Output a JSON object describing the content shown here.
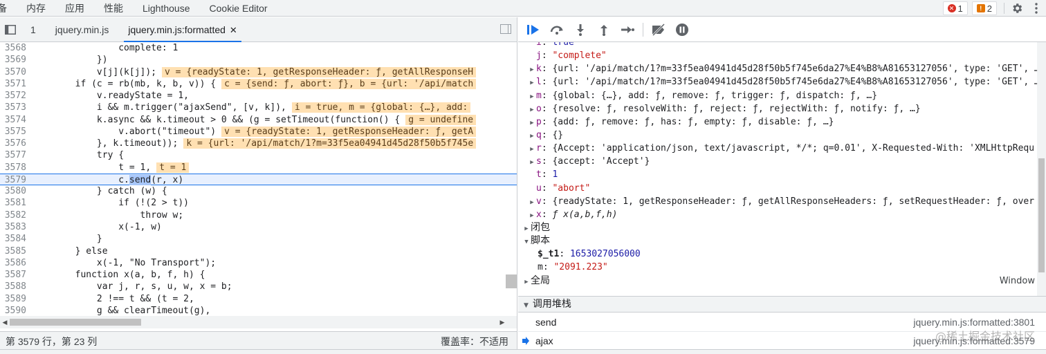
{
  "panel_tabs": [
    "备",
    "内存",
    "应用",
    "性能",
    "Lighthouse",
    "Cookie Editor"
  ],
  "issues": {
    "errors": "1",
    "warnings": "2"
  },
  "file_tabs": {
    "count_label": "1",
    "tab1": "jquery.min.js",
    "tab2": "jquery.min.js:formatted",
    "close": "✕"
  },
  "code_lines": [
    {
      "ln": "3568",
      "indent": "                ",
      "code": "complete: 1",
      "inline": ""
    },
    {
      "ln": "3569",
      "indent": "            ",
      "code": "})",
      "inline": ""
    },
    {
      "ln": "3570",
      "indent": "            ",
      "code": "v[j](k[j]);",
      "inline": "v = {readyState: 1, getResponseHeader: ƒ, getAllResponseH"
    },
    {
      "ln": "3571",
      "indent": "        ",
      "code": "if (c = rb(mb, k, b, v)) {",
      "inline": "c = {send: ƒ, abort: ƒ}, b = {url: '/api/match"
    },
    {
      "ln": "3572",
      "indent": "            ",
      "code": "v.readyState = 1,",
      "inline": ""
    },
    {
      "ln": "3573",
      "indent": "            ",
      "code": "i && m.trigger(\"ajaxSend\", [v, k]),",
      "inline": "i = true, m = {global: {…}, add:"
    },
    {
      "ln": "3574",
      "indent": "            ",
      "code": "k.async && k.timeout > 0 && (g = setTimeout(function() {",
      "inline": "g = undefine"
    },
    {
      "ln": "3575",
      "indent": "                ",
      "code": "v.abort(\"timeout\")",
      "inline": "v = {readyState: 1, getResponseHeader: ƒ, getA"
    },
    {
      "ln": "3576",
      "indent": "            ",
      "code": "}, k.timeout));",
      "inline": "k = {url: '/api/match/1?m=33f5ea04941d45d28f50b5f745e"
    },
    {
      "ln": "3577",
      "indent": "            ",
      "code": "try {",
      "inline": ""
    },
    {
      "ln": "3578",
      "indent": "                ",
      "code": "t = 1,",
      "inline": "t = 1"
    },
    {
      "ln": "3579",
      "indent": "                ",
      "code": "c.send(r, x)",
      "inline": ""
    },
    {
      "ln": "3580",
      "indent": "            ",
      "code": "} catch (w) {",
      "inline": ""
    },
    {
      "ln": "3581",
      "indent": "                ",
      "code": "if (!(2 > t))",
      "inline": ""
    },
    {
      "ln": "3582",
      "indent": "                    ",
      "code": "throw w;",
      "inline": ""
    },
    {
      "ln": "3583",
      "indent": "                ",
      "code": "x(-1, w)",
      "inline": ""
    },
    {
      "ln": "3584",
      "indent": "            ",
      "code": "}",
      "inline": ""
    },
    {
      "ln": "3585",
      "indent": "        ",
      "code": "} else",
      "inline": ""
    },
    {
      "ln": "3586",
      "indent": "            ",
      "code": "x(-1, \"No Transport\");",
      "inline": ""
    },
    {
      "ln": "3587",
      "indent": "        ",
      "code": "function x(a, b, f, h) {",
      "inline": ""
    },
    {
      "ln": "3588",
      "indent": "            ",
      "code": "var j, r, s, u, w, x = b;",
      "inline": ""
    },
    {
      "ln": "3589",
      "indent": "            ",
      "code": "2 !== t && (t = 2,",
      "inline": ""
    },
    {
      "ln": "3590",
      "indent": "            ",
      "code": "g && clearTimeout(g),",
      "inline": ""
    }
  ],
  "current_line": "3579",
  "status": {
    "position": "第 3579 行，第 23 列",
    "coverage": "覆盖率：不适用"
  },
  "scope_rows": [
    {
      "tri": "",
      "key": "i",
      "val": "true",
      "kind": "snum",
      "plain": false
    },
    {
      "tri": "",
      "key": "j",
      "val": "\"complete\"",
      "kind": "sstr",
      "plain": false
    },
    {
      "tri": "▶",
      "key": "k",
      "val": "{url: '/api/match/1?m=33f5ea04941d45d28f50b5f745e6da27%E4%B8%A81653127056', type: 'GET', …",
      "kind": "val",
      "plain": false
    },
    {
      "tri": "▶",
      "key": "l",
      "val": "{url: '/api/match/1?m=33f5ea04941d45d28f50b5f745e6da27%E4%B8%A81653127056', type: 'GET', …",
      "kind": "val",
      "plain": false
    },
    {
      "tri": "▶",
      "key": "m",
      "val": "{global: {…}, add: ƒ, remove: ƒ, trigger: ƒ, dispatch: ƒ, …}",
      "kind": "val",
      "plain": false
    },
    {
      "tri": "▶",
      "key": "o",
      "val": "{resolve: ƒ, resolveWith: ƒ, reject: ƒ, rejectWith: ƒ, notify: ƒ, …}",
      "kind": "val",
      "plain": false
    },
    {
      "tri": "▶",
      "key": "p",
      "val": "{add: ƒ, remove: ƒ, has: ƒ, empty: ƒ, disable: ƒ, …}",
      "kind": "val",
      "plain": false
    },
    {
      "tri": "▶",
      "key": "q",
      "val": "{}",
      "kind": "val",
      "plain": false
    },
    {
      "tri": "▶",
      "key": "r",
      "val": "{Accept: 'application/json, text/javascript, */*; q=0.01', X-Requested-With: 'XMLHttpRequ",
      "kind": "val",
      "plain": false
    },
    {
      "tri": "▶",
      "key": "s",
      "val": "{accept: 'Accept'}",
      "kind": "val",
      "plain": false
    },
    {
      "tri": "",
      "key": "t",
      "val": "1",
      "kind": "snum",
      "plain": false
    },
    {
      "tri": "",
      "key": "u",
      "val": "\"abort\"",
      "kind": "sstr",
      "plain": false
    },
    {
      "tri": "▶",
      "key": "v",
      "val": "{readyState: 1, getResponseHeader: ƒ, getAllResponseHeaders: ƒ, setRequestHeader: ƒ, over",
      "kind": "val",
      "plain": false
    },
    {
      "tri": "▶",
      "key": "x",
      "val": "ƒ x(a,b,f,h)",
      "kind": "fn",
      "plain": false
    }
  ],
  "scope_sections": {
    "closure": "闭包",
    "script": "脚本",
    "script_t1_key": "$_t1",
    "script_t1_val": "1653027056000",
    "script_m_key": "m",
    "script_m_val": "\"2091.223\"",
    "global": "全局",
    "global_value": "Window"
  },
  "callstack": {
    "title": "调用堆栈",
    "frames": [
      {
        "name": "send",
        "location": "jquery.min.js:formatted:3801"
      },
      {
        "name": "ajax",
        "location": "jquery.min.js:formatted:3579"
      }
    ]
  },
  "watermark": "@稀土掘金技术社区",
  "colors": {
    "accent": "#1a73e8",
    "inline_value_bg": "#ffe0b2",
    "current_line_bg": "#e8f0fe"
  }
}
